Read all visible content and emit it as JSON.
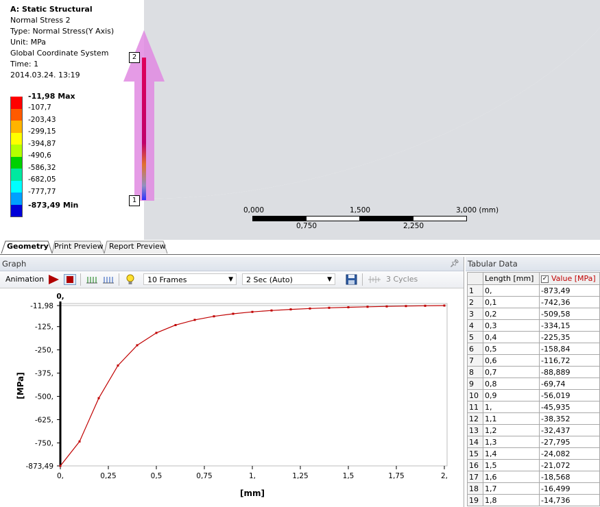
{
  "viewport": {
    "info_lines": [
      "A: Static Structural",
      "Normal Stress 2",
      "Type: Normal Stress(Y Axis)",
      "Unit: MPa",
      "Global Coordinate System",
      "Time: 1",
      "2014.03.24. 13:19"
    ],
    "legend": {
      "labels": [
        "-11,98 Max",
        "-107,7",
        "-203,43",
        "-299,15",
        "-394,87",
        "-490,6",
        "-586,32",
        "-682,05",
        "-777,77",
        "-873,49 Min"
      ],
      "colors": [
        "#ff0000",
        "#ff5a00",
        "#ffb400",
        "#ffff00",
        "#b4ff00",
        "#00d000",
        "#00e8a0",
        "#00ffff",
        "#00a0ff",
        "#0028ff",
        "#0000d8"
      ]
    },
    "path_markers": [
      "1",
      "2"
    ],
    "scale": {
      "top_labels": [
        "0,000",
        "1,500",
        "3,000 (mm)"
      ],
      "bottom_labels": [
        "0,750",
        "2,250"
      ]
    }
  },
  "tabs": [
    "Geometry",
    "Print Preview",
    "Report Preview"
  ],
  "graph": {
    "title": "Graph",
    "pin_icon": "pin-icon",
    "toolbar": {
      "animation_label": "Animation",
      "frames_value": "10 Frames",
      "duration_value": "2 Sec (Auto)",
      "cycles_label": "3 Cycles"
    }
  },
  "chart_data": {
    "type": "line",
    "ylabel": "[MPa]",
    "xlabel": "[mm]",
    "x_ticks": [
      "0,",
      "0,25",
      "0,5",
      "0,75",
      "1,",
      "1,25",
      "1,5",
      "1,75",
      "2,"
    ],
    "y_ticks": [
      "-11,98",
      "-125,",
      "-250,",
      "-375,",
      "-500,",
      "-625,",
      "-750,",
      "-873,49"
    ],
    "cursor_label": "0,",
    "xlim": [
      0,
      2
    ],
    "ylim": [
      -873.49,
      -11.98
    ],
    "line_color": "#c00000",
    "series": [
      {
        "x": [
          0,
          0.1,
          0.2,
          0.3,
          0.4,
          0.5,
          0.6,
          0.7,
          0.8,
          0.9,
          1.0,
          1.1,
          1.2,
          1.3,
          1.4,
          1.5,
          1.6,
          1.7,
          1.8,
          1.9,
          2.0
        ],
        "values": [
          -873.49,
          -742.36,
          -509.58,
          -334.15,
          -225.35,
          -158.84,
          -116.72,
          -88.889,
          -69.74,
          -56.019,
          -45.935,
          -38.352,
          -32.437,
          -27.795,
          -24.082,
          -21.072,
          -18.568,
          -16.499,
          -14.736,
          -13.2,
          -11.98
        ]
      }
    ]
  },
  "tabular": {
    "title": "Tabular Data",
    "headers": [
      "Length [mm]",
      "Value [MPa]"
    ],
    "rows": [
      [
        "1",
        "0,",
        "-873,49"
      ],
      [
        "2",
        "0,1",
        "-742,36"
      ],
      [
        "3",
        "0,2",
        "-509,58"
      ],
      [
        "4",
        "0,3",
        "-334,15"
      ],
      [
        "5",
        "0,4",
        "-225,35"
      ],
      [
        "6",
        "0,5",
        "-158,84"
      ],
      [
        "7",
        "0,6",
        "-116,72"
      ],
      [
        "8",
        "0,7",
        "-88,889"
      ],
      [
        "9",
        "0,8",
        "-69,74"
      ],
      [
        "10",
        "0,9",
        "-56,019"
      ],
      [
        "11",
        "1,",
        "-45,935"
      ],
      [
        "12",
        "1,1",
        "-38,352"
      ],
      [
        "13",
        "1,2",
        "-32,437"
      ],
      [
        "14",
        "1,3",
        "-27,795"
      ],
      [
        "15",
        "1,4",
        "-24,082"
      ],
      [
        "16",
        "1,5",
        "-21,072"
      ],
      [
        "17",
        "1,6",
        "-18,568"
      ],
      [
        "18",
        "1,7",
        "-16,499"
      ],
      [
        "19",
        "1,8",
        "-14,736"
      ]
    ]
  }
}
